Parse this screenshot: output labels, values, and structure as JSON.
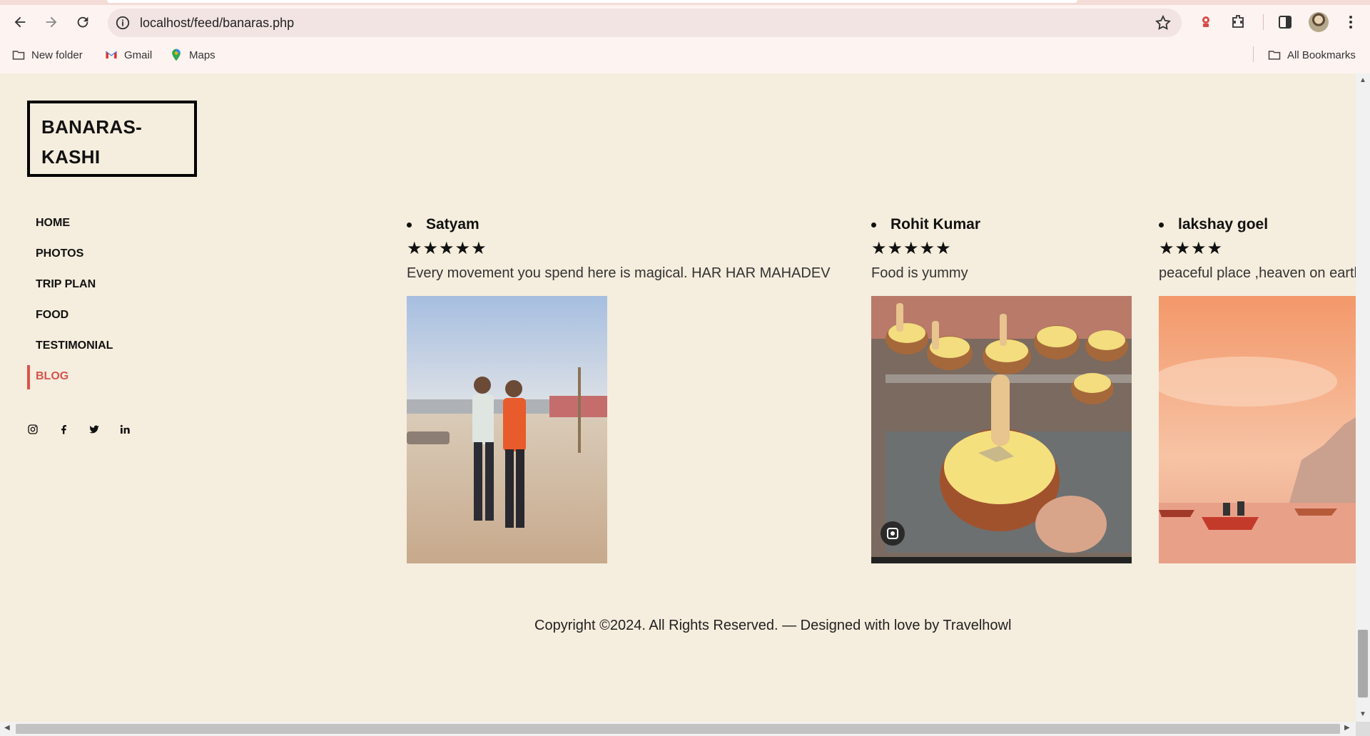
{
  "browser": {
    "url": "localhost/feed/banaras.php",
    "bookmarks": [
      "New folder",
      "Gmail",
      "Maps"
    ],
    "all_bookmarks": "All Bookmarks"
  },
  "site": {
    "logo_line1": "BANARAS-",
    "logo_line2": "KASHI",
    "menu": [
      "HOME",
      "PHOTOS",
      "TRIP PLAN",
      "FOOD",
      "TESTIMONIAL",
      "BLOG"
    ],
    "active_menu": "BLOG",
    "social_icons": [
      "instagram-icon",
      "facebook-icon",
      "twitter-icon",
      "linkedin-icon"
    ],
    "accent_color": "#d9534f",
    "background_color": "#f5eddd"
  },
  "posts": [
    {
      "name": "Satyam",
      "stars": "★★★★★",
      "rating": 5,
      "text": "Every movement you spend here is magical. HAR HAR MAHADEV"
    },
    {
      "name": "Rohit Kumar",
      "stars": "★★★★★",
      "rating": 5,
      "text": "Food is yummy"
    },
    {
      "name": "lakshay goel",
      "stars": "★★★★",
      "rating": 4,
      "text": "peaceful place ,heaven on earth"
    }
  ],
  "footer": {
    "copyright": "Copyright ©2024. All Rights Reserved. — Designed with love by Travelhowl"
  }
}
